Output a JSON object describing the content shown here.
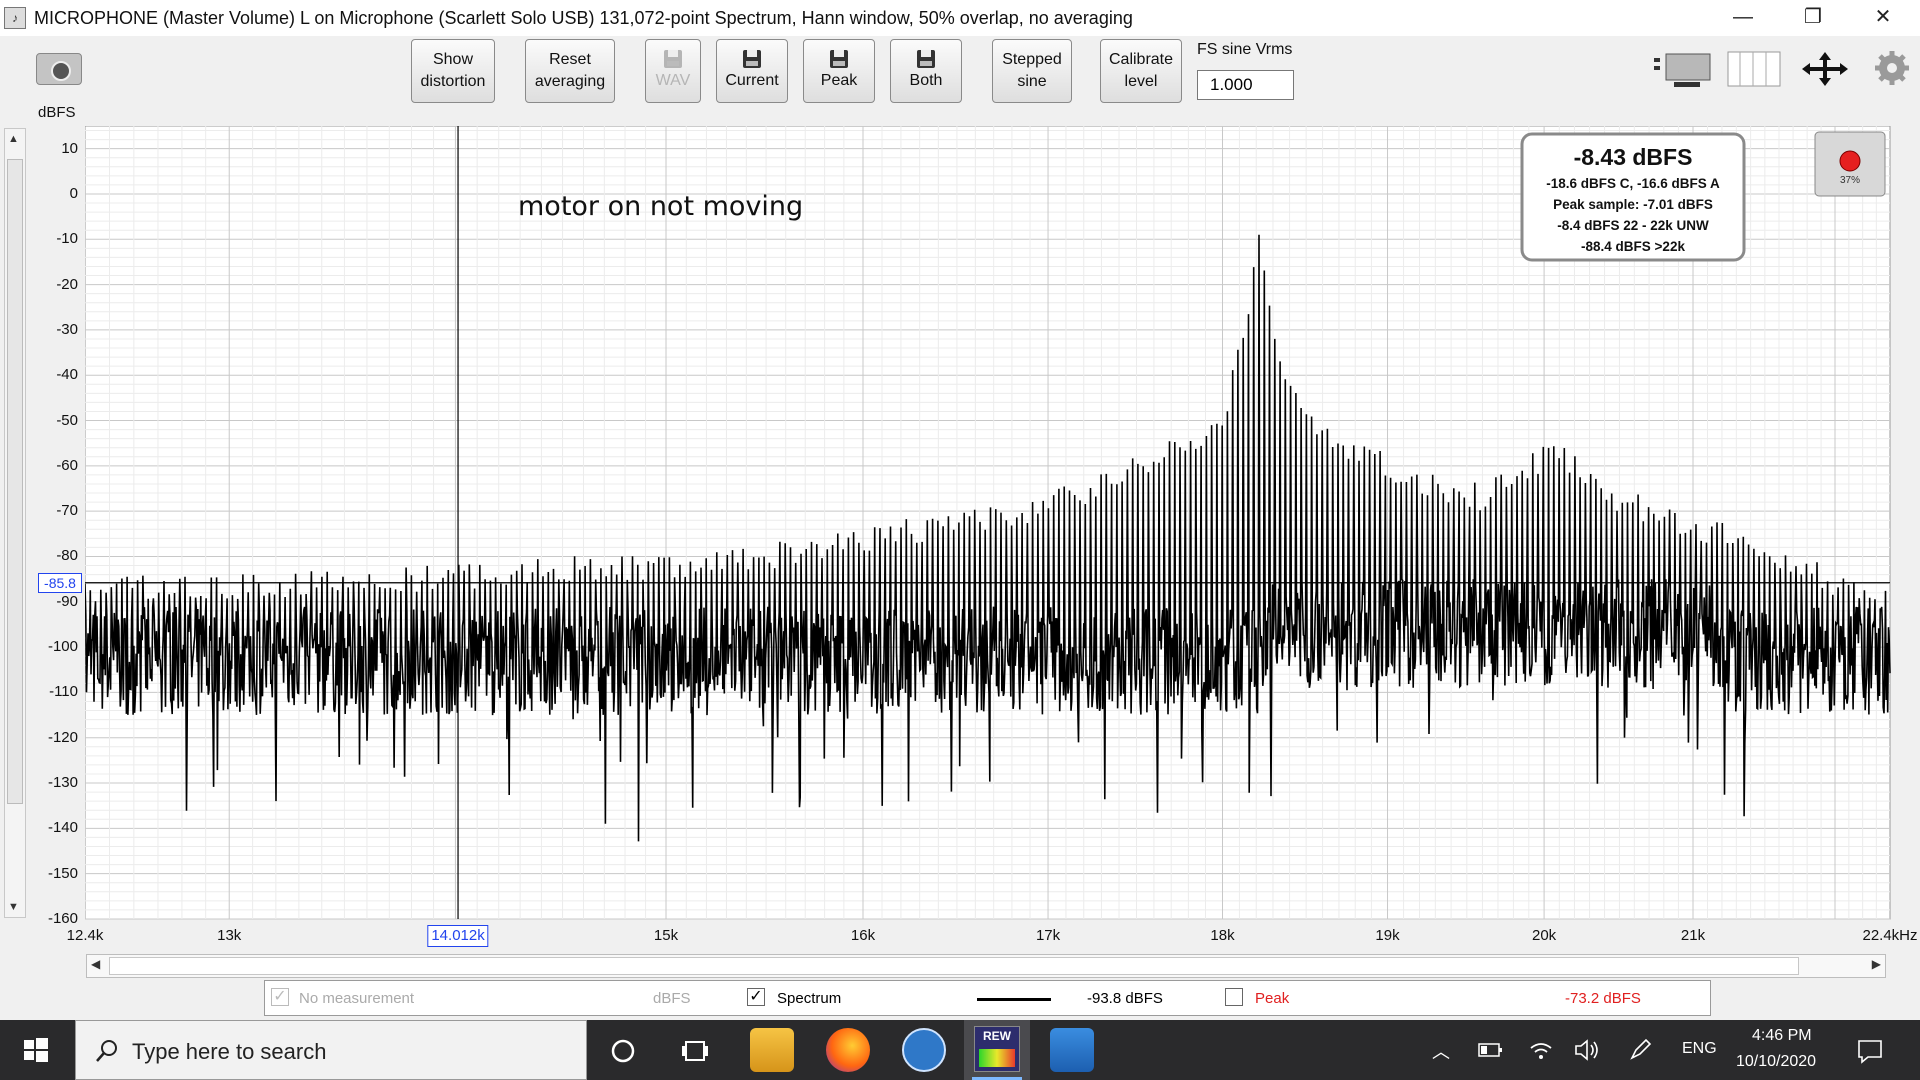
{
  "window": {
    "title": "MICROPHONE (Master Volume) L on Microphone (Scarlett Solo USB) 131,072-point Spectrum, Hann window, 50% overlap, no averaging",
    "controls": {
      "minimize": "—",
      "restore": "❐",
      "close": "✕"
    }
  },
  "toolbar": {
    "show_distortion": [
      "Show",
      "distortion"
    ],
    "reset_averaging": [
      "Reset",
      "averaging"
    ],
    "wav": "WAV",
    "current": "Current",
    "peak": "Peak",
    "both": "Both",
    "stepped_sine": [
      "Stepped",
      "sine"
    ],
    "calibrate_level": [
      "Calibrate",
      "level"
    ],
    "fs_label": "FS sine Vrms",
    "fs_value": "1.000"
  },
  "chart_data": {
    "type": "line",
    "title": "",
    "ylabel": "dBFS",
    "xlabel": "",
    "xunit_suffix": "Hz",
    "x_scale": "log",
    "xlim": [
      12400,
      22400
    ],
    "ylim": [
      -160,
      15
    ],
    "grid": true,
    "y_ticks": [
      10,
      0,
      -10,
      -20,
      -30,
      -40,
      -50,
      -60,
      -70,
      -80,
      -90,
      -100,
      -110,
      -120,
      -130,
      -140,
      -150,
      -160
    ],
    "x_ticks": [
      {
        "value": 12400,
        "label": "12.4k"
      },
      {
        "value": 13000,
        "label": "13k"
      },
      {
        "value": 15000,
        "label": "15k"
      },
      {
        "value": 16000,
        "label": "16k"
      },
      {
        "value": 17000,
        "label": "17k"
      },
      {
        "value": 18000,
        "label": "18k"
      },
      {
        "value": 19000,
        "label": "19k"
      },
      {
        "value": 20000,
        "label": "20k"
      },
      {
        "value": 21000,
        "label": "21k"
      },
      {
        "value": 22400,
        "label": "22.4kHz"
      }
    ],
    "cursor": {
      "x": 14012,
      "x_label": "14.012k",
      "y": -85.8,
      "y_label": "-85.8"
    },
    "annotation": "motor on not moving",
    "series": [
      {
        "name": "Spectrum",
        "color": "#000000",
        "noise_floor_db": -103,
        "noise_spread_db": 12,
        "peaks": [
          {
            "x": 12450,
            "y": -84
          },
          {
            "x": 12900,
            "y": -84
          },
          {
            "x": 13400,
            "y": -83
          },
          {
            "x": 13900,
            "y": -82
          },
          {
            "x": 14500,
            "y": -80
          },
          {
            "x": 15000,
            "y": -79
          },
          {
            "x": 15500,
            "y": -77
          },
          {
            "x": 16000,
            "y": -73
          },
          {
            "x": 16500,
            "y": -70
          },
          {
            "x": 17000,
            "y": -66
          },
          {
            "x": 17500,
            "y": -58
          },
          {
            "x": 17800,
            "y": -52
          },
          {
            "x": 18000,
            "y": -47
          },
          {
            "x": 18100,
            "y": -33
          },
          {
            "x": 18220,
            "y": -9
          },
          {
            "x": 18350,
            "y": -34
          },
          {
            "x": 18500,
            "y": -48
          },
          {
            "x": 18800,
            "y": -54
          },
          {
            "x": 19200,
            "y": -61
          },
          {
            "x": 19600,
            "y": -64
          },
          {
            "x": 20050,
            "y": -54
          },
          {
            "x": 20500,
            "y": -65
          },
          {
            "x": 21000,
            "y": -70
          },
          {
            "x": 21500,
            "y": -75
          },
          {
            "x": 22000,
            "y": -83
          },
          {
            "x": 22400,
            "y": -86
          }
        ]
      }
    ]
  },
  "readout": {
    "main": "-8.43 dBFS",
    "weighted": "-18.6 dBFS C, -16.6 dBFS A",
    "peak_sample": "Peak sample: -7.01 dBFS",
    "band_unw": "-8.4 dBFS 22 - 22k UNW",
    "above_22k": "-88.4 dBFS >22k"
  },
  "record": {
    "level": "37%"
  },
  "legend": {
    "no_measurement": "No measurement",
    "no_measurement_unit": "dBFS",
    "spectrum": "Spectrum",
    "spectrum_value": "-93.8 dBFS",
    "peak": "Peak",
    "peak_value": "-73.2 dBFS",
    "peak_color": "#e02020"
  },
  "taskbar": {
    "search_placeholder": "Type here to search",
    "language": "ENG",
    "time": "4:46 PM",
    "date": "10/10/2020",
    "rew_badge": "REW"
  }
}
